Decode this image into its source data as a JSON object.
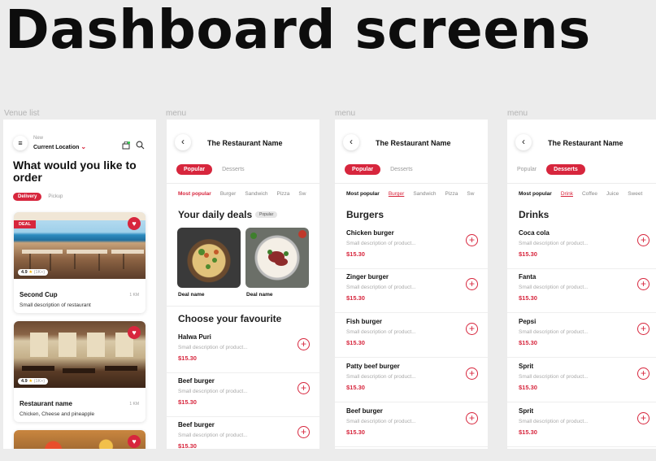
{
  "page_title": "Dashboard screens",
  "labels": [
    "Venue list",
    "menu",
    "menu",
    "menu"
  ],
  "venue": {
    "location_top": "New",
    "location_main": "Current Location",
    "headline": "What would you like to order",
    "tabs": [
      "Delivery",
      "Pickup"
    ],
    "cards": [
      {
        "badge": "DEAL",
        "name": "Second Cup",
        "distance": "1 KM",
        "desc": "Small description of restaurant",
        "rating": "4.9",
        "reviews": "(1K+)"
      },
      {
        "badge": "",
        "name": "Restaurant name",
        "distance": "1 KM",
        "desc": "Chicken, Cheese and pineapple",
        "rating": "4.9",
        "reviews": "(1K+)"
      }
    ]
  },
  "menu1": {
    "restaurant": "The Restaurant Name",
    "pills": [
      "Popular",
      "Desserts"
    ],
    "cats": [
      "Most popular",
      "Burger",
      "Sandwich",
      "Pizza",
      "Sw"
    ],
    "deals_title": "Your daily deals",
    "deals_badge": "Popular",
    "deals": [
      "Deal name",
      "Deal name"
    ],
    "fav_title": "Choose your favourite",
    "items": [
      {
        "name": "Halwa Puri",
        "desc": "Small description of product...",
        "price": "$15.30"
      },
      {
        "name": "Beef burger",
        "desc": "Small description of product...",
        "price": "$15.30"
      },
      {
        "name": "Beef burger",
        "desc": "Small description of product...",
        "price": "$15.30"
      }
    ]
  },
  "menu2": {
    "restaurant": "The Restaurant Name",
    "pills": [
      "Popular",
      "Desserts"
    ],
    "cats": [
      "Most popular",
      "Burger",
      "Sandwich",
      "Pizza",
      "Sw"
    ],
    "section": "Burgers",
    "items": [
      {
        "name": "Chicken burger",
        "desc": "Small description of product...",
        "price": "$15.30"
      },
      {
        "name": "Zinger burger",
        "desc": "Small description of product...",
        "price": "$15.30"
      },
      {
        "name": "Fish burger",
        "desc": "Small description of product...",
        "price": "$15.30"
      },
      {
        "name": "Patty beef burger",
        "desc": "Small description of product...",
        "price": "$15.30"
      },
      {
        "name": "Beef burger",
        "desc": "Small description of product...",
        "price": "$15.30"
      }
    ]
  },
  "menu3": {
    "restaurant": "The Restaurant Name",
    "pills": [
      "Popular",
      "Desserts"
    ],
    "cats": [
      "Most popular",
      "Drink",
      "Coffee",
      "Juice",
      "Sweet"
    ],
    "section": "Drinks",
    "items": [
      {
        "name": "Coca cola",
        "desc": "Small description of product...",
        "price": "$15.30"
      },
      {
        "name": "Fanta",
        "desc": "Small description of product...",
        "price": "$15.30"
      },
      {
        "name": "Pepsi",
        "desc": "Small description of product...",
        "price": "$15.30"
      },
      {
        "name": "Sprit",
        "desc": "Small description of product...",
        "price": "$15.30"
      },
      {
        "name": "Sprit",
        "desc": "Small description of product...",
        "price": "$15.30"
      }
    ]
  },
  "colors": {
    "accent": "#d7263d",
    "background": "#ececec"
  }
}
